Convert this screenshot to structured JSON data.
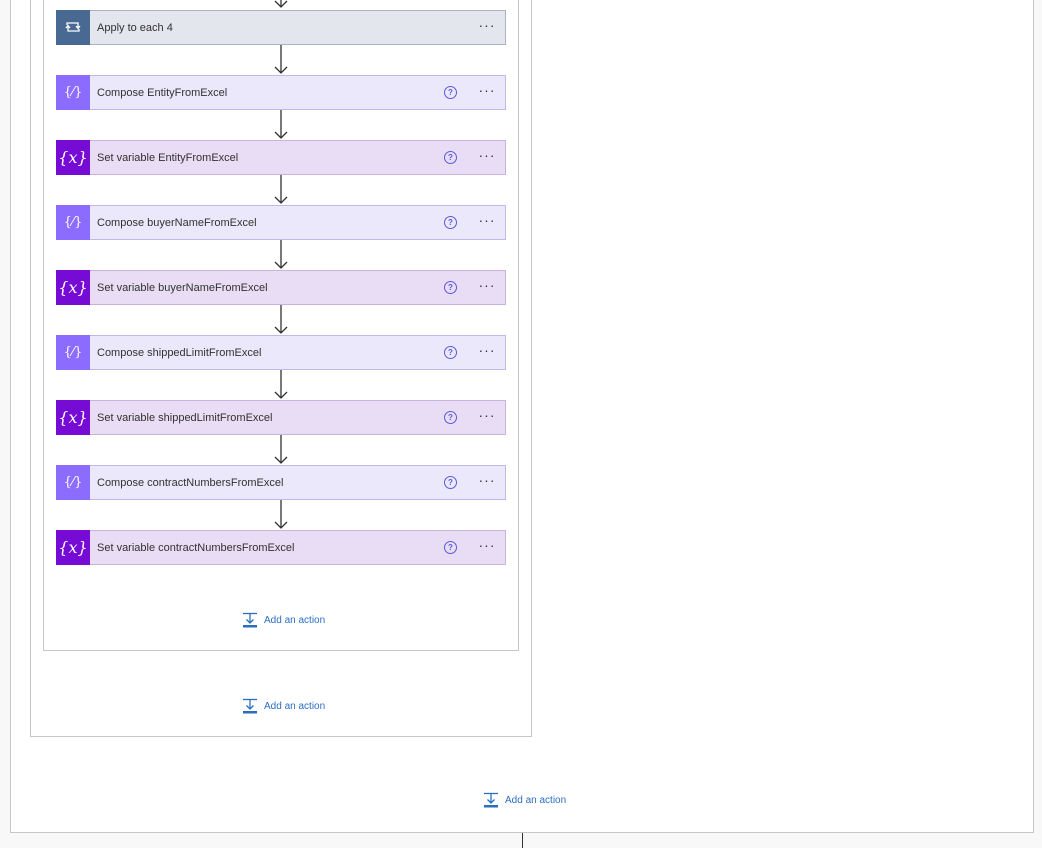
{
  "flow": {
    "steps": [
      {
        "type": "loop",
        "title": "Apply to each 4",
        "icon": "loop-icon",
        "has_help": false
      },
      {
        "type": "compose",
        "title": "Compose EntityFromExcel",
        "icon": "compose-icon",
        "has_help": true
      },
      {
        "type": "setvar",
        "title": "Set variable EntityFromExcel",
        "icon": "variable-icon",
        "has_help": true
      },
      {
        "type": "compose",
        "title": "Compose buyerNameFromExcel",
        "icon": "compose-icon",
        "has_help": true
      },
      {
        "type": "setvar",
        "title": "Set variable buyerNameFromExcel",
        "icon": "variable-icon",
        "has_help": true
      },
      {
        "type": "compose",
        "title": "Compose shippedLimitFromExcel",
        "icon": "compose-icon",
        "has_help": true
      },
      {
        "type": "setvar",
        "title": "Set variable shippedLimitFromExcel",
        "icon": "variable-icon",
        "has_help": true
      },
      {
        "type": "compose",
        "title": "Compose contractNumbersFromExcel",
        "icon": "compose-icon",
        "has_help": true
      },
      {
        "type": "setvar",
        "title": "Set variable contractNumbersFromExcel",
        "icon": "variable-icon",
        "has_help": true
      }
    ],
    "help_glyph": "?",
    "more_glyph": "···",
    "variable_glyph": "{x}",
    "compose_glyph": "{⁄}"
  },
  "add_actions": {
    "inner": "Add an action",
    "middle": "Add an action",
    "outer": "Add an action"
  },
  "colors": {
    "loop_accent": "#486991",
    "compose_accent": "#8c6cff",
    "variable_accent": "#770bd6",
    "link": "#2a6ebf"
  }
}
